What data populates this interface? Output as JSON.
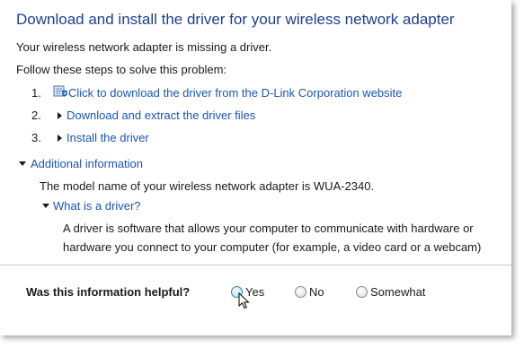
{
  "title": "Download and install the driver for your wireless network adapter",
  "intro": "Your wireless network adapter is missing a driver.",
  "steps_heading": "Follow these steps to solve this problem:",
  "steps": [
    {
      "number": "1.",
      "label": "Click to download the driver from the D-Link Corporation website",
      "icon": "download-shield-icon"
    },
    {
      "number": "2.",
      "label": "Download and extract the driver files",
      "icon": "expand-arrow-icon"
    },
    {
      "number": "3.",
      "label": "Install the driver",
      "icon": "expand-arrow-icon"
    }
  ],
  "additional": {
    "label": "Additional information",
    "model_text": "The model name of your wireless network adapter is WUA-2340.",
    "what_is": {
      "label": "What is a driver?",
      "line1": "A driver is software that allows your computer to communicate with hardware or",
      "line2": "hardware you connect to your computer (for example, a video card or a webcam)"
    }
  },
  "feedback": {
    "question": "Was this information helpful?",
    "options": [
      "Yes",
      "No",
      "Somewhat"
    ],
    "hovered": "Yes"
  },
  "colors": {
    "title": "#1e3f8f",
    "link": "#1a55b4",
    "text": "#1a1a1a"
  }
}
